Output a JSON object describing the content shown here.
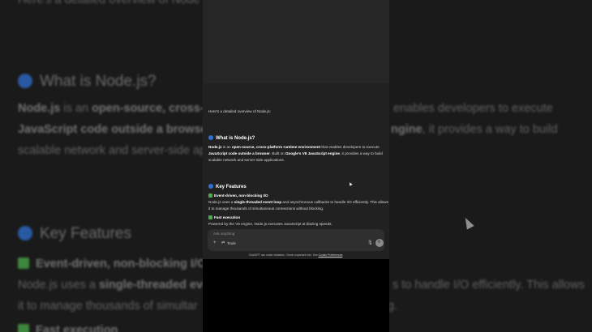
{
  "background": {
    "top_line": "Here's a detailed overview of Node",
    "heading1": "What is Node.js?",
    "p1_line1_a": "Node.js",
    "p1_line1_b": " is an ",
    "p1_line1_c": "open-source, cross-p",
    "p1_line1_d": "enables developers to execute",
    "p1_line2_a": "JavaScript code outside a browser",
    "p1_line2_b": "ngine",
    "p1_line2_c": ", it provides a way to build",
    "p1_line3": "scalable network and server-side ap",
    "heading2": "Key Features",
    "feature1_title": "Event-driven, non-blocking I/C",
    "p2_line1_a": "Node.js uses a ",
    "p2_line1_b": "single-threaded eve",
    "p2_line1_c": "s to handle I/O efficiently. This allows",
    "p2_line2_a": "it to manage thousands of simultar",
    "p2_line2_b": "g.",
    "feature2_title": "Fast execution"
  },
  "chat": {
    "intro": "Here's a detailed overview of Node.js:",
    "section1_title": "What is Node.js?",
    "section1_p": {
      "a": "Node.js",
      "b": " is an ",
      "c": "open-source, cross-platform runtime environment",
      "d": " that enables developers to execute ",
      "e": "JavaScript code outside a browser",
      "f": ". Built on ",
      "g": "Google's V8 JavaScript engine",
      "h": ", it provides a way to build scalable network and server-side applications."
    },
    "section2_title": "Key Features",
    "feature1_title": "Event-driven, non-blocking I/O",
    "feature1_p": {
      "a": "Node.js uses a ",
      "b": "single-threaded event loop",
      "c": " and asynchronous callbacks to handle I/O efficiently. This allows it to manage thousands of simultaneous connections without blocking."
    },
    "feature2_title": "Fast execution",
    "feature2_p": "Powered by the V8 engine, Node.js executes JavaScript at blazing speeds."
  },
  "composer": {
    "placeholder": "Ask anything",
    "plus_icon": "+",
    "tools_label": "Tools"
  },
  "disclaimer": {
    "text": "ChatGPT can make mistakes. Check important info. See ",
    "link": "Cookie Preferences",
    "end": "."
  },
  "colors": {
    "accent_blue": "#2f6fd1",
    "check_green": "#4caa4a",
    "chat_bg": "#212121",
    "composer_bg": "#2f2f2f"
  }
}
